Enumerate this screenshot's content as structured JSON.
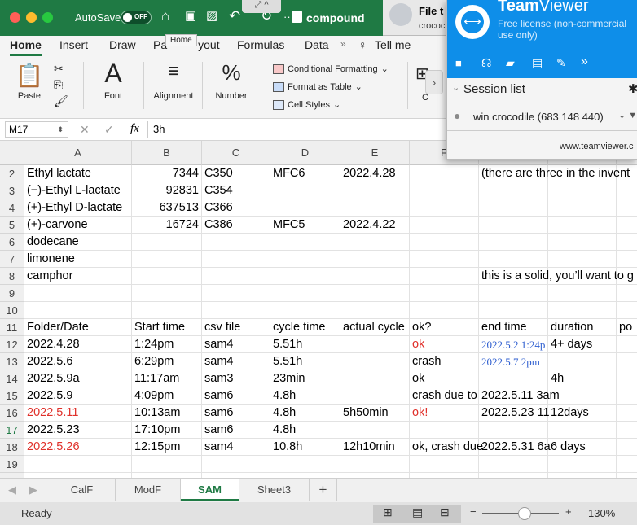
{
  "titlebar": {
    "autosave_label": "AutoSave",
    "autosave_state": "OFF",
    "doc_title": "compound",
    "tooltip": "Home",
    "ellipsis": "···"
  },
  "ribbon_tabs": [
    "Home",
    "Insert",
    "Draw",
    "Page Layout",
    "Formulas",
    "Data",
    "Tell me"
  ],
  "ribbon": {
    "paste": "Paste",
    "font": "Font",
    "alignment": "Alignment",
    "number": "Number",
    "conditional_formatting": "Conditional Formatting",
    "format_as_table": "Format as Table",
    "cell_styles": "Cell Styles",
    "cells_initial": "C"
  },
  "formula_bar": {
    "name_box": "M17",
    "fx": "fx",
    "value": "3h"
  },
  "columns": [
    "A",
    "B",
    "C",
    "D",
    "E",
    "F"
  ],
  "rows": [
    {
      "n": "2",
      "a": "Ethyl lactate",
      "b": "7344",
      "c": "C350",
      "d": "MFC6",
      "e": "2022.4.28",
      "f": "",
      "g": "(there are three in the invent"
    },
    {
      "n": "3",
      "a": "(−)-Ethyl L-lactate",
      "b": "92831",
      "c": "C354",
      "d": "",
      "e": "",
      "f": "",
      "g": ""
    },
    {
      "n": "4",
      "a": "(+)-Ethyl D-lactate",
      "b": "637513",
      "c": "C366",
      "d": "",
      "e": "",
      "f": "",
      "g": ""
    },
    {
      "n": "5",
      "a": "(+)-carvone",
      "b": "16724",
      "c": "C386",
      "d": "MFC5",
      "e": "2022.4.22",
      "f": "",
      "g": ""
    },
    {
      "n": "6",
      "a": "dodecane",
      "b": "",
      "c": "",
      "d": "",
      "e": "",
      "f": "",
      "g": ""
    },
    {
      "n": "7",
      "a": "limonene",
      "b": "",
      "c": "",
      "d": "",
      "e": "",
      "f": "",
      "g": ""
    },
    {
      "n": "8",
      "a": "camphor",
      "b": "",
      "c": "",
      "d": "",
      "e": "",
      "f": "",
      "g": "this is a solid, you’ll want to g"
    },
    {
      "n": "9",
      "a": "",
      "b": "",
      "c": "",
      "d": "",
      "e": "",
      "f": "",
      "g": ""
    },
    {
      "n": "10",
      "a": "",
      "b": "",
      "c": "",
      "d": "",
      "e": "",
      "f": "",
      "g": ""
    },
    {
      "n": "11",
      "a": "Folder/Date",
      "b": "Start time",
      "c": "csv file",
      "d": "cycle time",
      "e": "actual cycle",
      "f": "ok?",
      "g": "end time",
      "h": "duration",
      "i": "po"
    },
    {
      "n": "12",
      "a": "2022.4.28",
      "b": "1:24pm",
      "c": "sam4",
      "d": "5.51h",
      "e": "",
      "f": "ok",
      "g": "2022.5.2 1:24p",
      "h": "4+ days"
    },
    {
      "n": "13",
      "a": "2022.5.6",
      "b": "6:29pm",
      "c": "sam4",
      "d": "5.51h",
      "e": "",
      "f": "crash",
      "g": "2022.5.7 2pm",
      "h": ""
    },
    {
      "n": "14",
      "a": "2022.5.9a",
      "b": "11:17am",
      "c": "sam3",
      "d": "23min",
      "e": "",
      "f": "ok",
      "g": "",
      "h": "4h"
    },
    {
      "n": "15",
      "a": "2022.5.9",
      "b": "4:09pm",
      "c": "sam6",
      "d": "4.8h",
      "e": "",
      "f": "crash due to",
      "g": "2022.5.11 3am",
      "h": ""
    },
    {
      "n": "16",
      "a": "2022.5.11",
      "b": "10:13am",
      "c": "sam6",
      "d": "4.8h",
      "e": "5h50min",
      "f": "ok!",
      "g": "2022.5.23 11",
      "h": "12days"
    },
    {
      "n": "17",
      "a": "2022.5.23",
      "b": "17:10pm",
      "c": "sam6",
      "d": "4.8h",
      "e": "",
      "f": "",
      "g": "",
      "h": ""
    },
    {
      "n": "18",
      "a": "2022.5.26",
      "b": "12:15pm",
      "c": "sam4",
      "d": "10.8h",
      "e": "12h10min",
      "f": "ok, crash due",
      "g": "2022.5.31 6a",
      "h": "6 days"
    },
    {
      "n": "19",
      "a": "",
      "b": "",
      "c": "",
      "d": "",
      "e": "",
      "f": "",
      "g": "",
      "h": ""
    },
    {
      "n": "20",
      "a": "",
      "b": "",
      "c": "",
      "d": "",
      "e": "",
      "f": "",
      "g": "",
      "h": ""
    }
  ],
  "sheet_tabs": [
    "CalF",
    "ModF",
    "SAM",
    "Sheet3"
  ],
  "active_sheet": "SAM",
  "add_sheet": "+",
  "status": {
    "ready": "Ready",
    "zoom": "130%",
    "minus": "−",
    "plus": "+"
  },
  "file_popup": {
    "title": "File t",
    "sub": "crococ"
  },
  "teamviewer": {
    "brand_bold": "Team",
    "brand_rest": "Viewer",
    "license": "Free license (non-commercial use only)",
    "session_list": "Session list",
    "session_item": "win crocodile (683 148 440)",
    "website": "www.teamviewer.c"
  },
  "colors": {
    "excel_green": "#1f7a44",
    "teamviewer_blue": "#0e8ee9",
    "red_text": "#e0302a",
    "blue_text": "#2f5fd0"
  }
}
